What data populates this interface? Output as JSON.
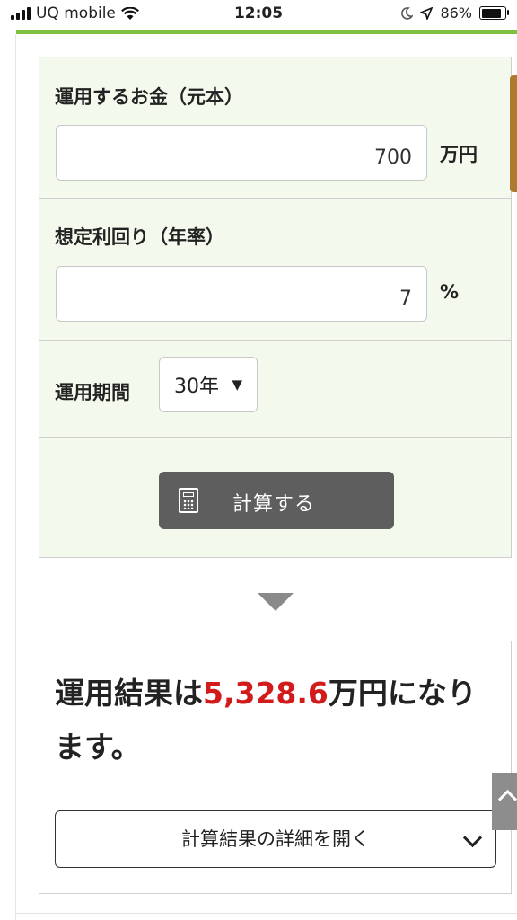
{
  "status_bar": {
    "carrier": "UQ mobile",
    "time": "12:05",
    "battery": "86%",
    "battery_level": 0.86,
    "icons": [
      "signal-icon",
      "wifi-icon",
      "moon-icon",
      "location-arrow-icon",
      "battery-icon"
    ]
  },
  "form": {
    "principal_label": "運用するお金（元本）",
    "principal_value": "700",
    "principal_unit": "万円",
    "rate_label": "想定利回り（年率）",
    "rate_value": "7",
    "rate_unit": "%",
    "period_label": "運用期間",
    "period_value": "30年",
    "calculate_label": "計算する"
  },
  "result": {
    "prefix": "運用結果は",
    "value": "5,328.6",
    "suffix": "万円になります。",
    "details_label": "計算結果の詳細を開く"
  },
  "colors": {
    "accent_green": "#7fc241",
    "form_background": "#f3f9ec",
    "result_highlight": "#d21b1b",
    "button_gray": "#5e5e5e"
  }
}
